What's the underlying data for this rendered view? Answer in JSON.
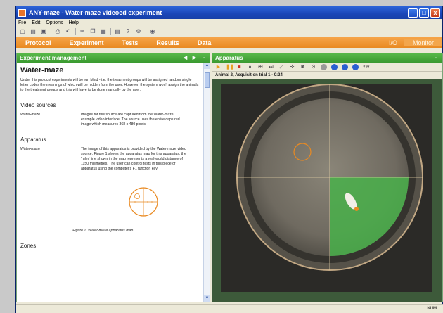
{
  "window": {
    "title": "ANY-maze - Water-maze videoed experiment"
  },
  "menu": [
    "File",
    "Edit",
    "Options",
    "Help"
  ],
  "nav": {
    "tabs": [
      "Protocol",
      "Experiment",
      "Tests",
      "Results",
      "Data"
    ],
    "io": "I/O",
    "monitor": "Monitor"
  },
  "left_panel": {
    "title": "Experiment management",
    "heading": "Water-maze",
    "intro": "Under this protocol experiments will be run blind - i.e. the treatment groups will be assigned random single letter codes the meanings of which will be hidden from the user. However, the system won't assign the animals to the treatment groups and this will have to be done manually by the user.",
    "video_sources_heading": "Video sources",
    "video_source_key": "Water-maze",
    "video_source_text": "Images for this source are captured from the Water-maze example video interface. The source uses the entire captured image which measures 368 x 480 pixels.",
    "apparatus_heading": "Apparatus",
    "apparatus_key": "Water-maze",
    "apparatus_text": "The image of this apparatus is provided by the Water-maze video source. Figure 1 shows the apparatus map for this apparatus, the 'ruler' line shown in the map represents a real-world distance of 1150 millimetres. The user can control tests in this piece of apparatus using the computer's F1 function key.",
    "figure_caption": "Figure 1. Water-maze apparatus map.",
    "zones_heading": "Zones"
  },
  "right_panel": {
    "title": "Apparatus",
    "info": "Animal 2, Acquisition trial 1 - 0:24"
  },
  "status": {
    "num": "NUM"
  },
  "colors": {
    "accent_orange": "#e98a22",
    "panel_green": "#3a9a30",
    "zone_green": "#49b04a",
    "title_blue": "#1a46b8"
  }
}
